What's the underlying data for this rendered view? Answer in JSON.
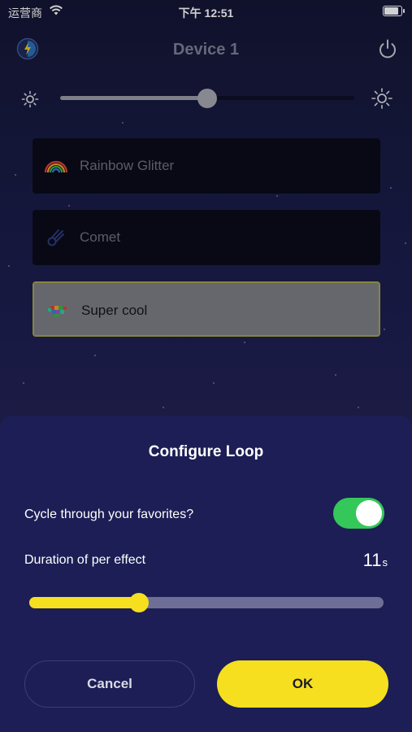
{
  "status_bar": {
    "carrier": "运营商",
    "time": "下午 12:51"
  },
  "header": {
    "title": "Device 1",
    "logo_icon": "app-logo-icon",
    "power_icon": "power-icon"
  },
  "brightness": {
    "level": 0.5,
    "min_icon": "sun-small-icon",
    "max_icon": "sun-large-icon"
  },
  "effects": [
    {
      "label": "Rainbow Glitter",
      "icon": "rainbow-icon",
      "selected": false
    },
    {
      "label": "Comet",
      "icon": "comet-icon",
      "selected": false
    },
    {
      "label": "Super cool",
      "icon": "pixel-art-icon",
      "selected": true
    }
  ],
  "dialog": {
    "title": "Configure Loop",
    "cycle_label": "Cycle through your favorites?",
    "cycle_enabled": true,
    "duration_label": "Duration of per effect",
    "duration_value": "11",
    "duration_unit": "s",
    "duration_fraction": 0.31,
    "cancel_label": "Cancel",
    "ok_label": "OK"
  },
  "colors": {
    "accent": "#f6df1f",
    "toggle_on": "#34c759",
    "sheet_bg": "#1c1e55"
  }
}
